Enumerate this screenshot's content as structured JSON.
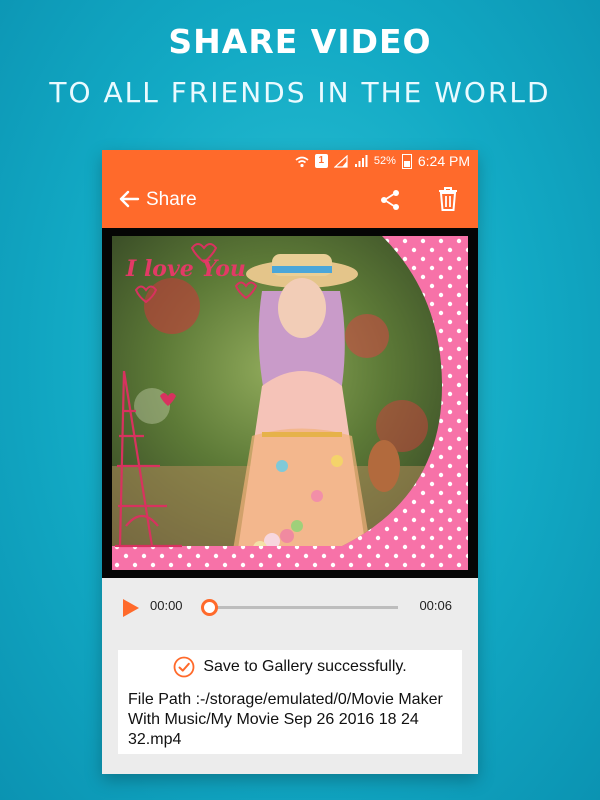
{
  "promo": {
    "headline": "SHARE VIDEO",
    "subheadline": "TO ALL FRIENDS IN THE WORLD"
  },
  "status_bar": {
    "sim_slot": "1",
    "battery": "52%",
    "time": "6:24 PM"
  },
  "app_bar": {
    "title": "Share",
    "back_icon": "arrow-left-icon",
    "share_icon": "share-icon",
    "delete_icon": "trash-icon"
  },
  "video": {
    "overlay_text": "I love You"
  },
  "player": {
    "current_time": "00:00",
    "total_time": "00:06",
    "progress": 0
  },
  "result": {
    "message": "Save to Gallery successfully.",
    "file_path": "File Path :-/storage/emulated/0/Movie Maker With Music/My Movie Sep 26 2016 18 24 32.mp4"
  },
  "colors": {
    "accent": "#ff6a2b",
    "background": "#12a9c4",
    "pink_frame": "#f772a8"
  }
}
